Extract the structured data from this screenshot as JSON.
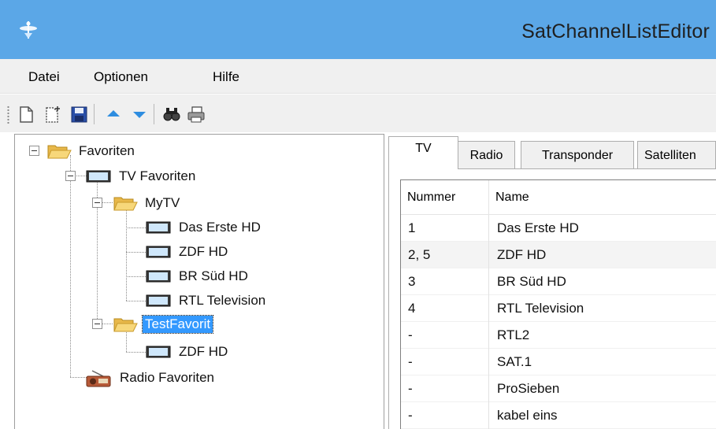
{
  "window": {
    "title": "SatChannelListEditor"
  },
  "menu": {
    "items": [
      "Datei",
      "Optionen",
      "Hilfe"
    ]
  },
  "toolbar": {
    "buttons": [
      "new-document-icon",
      "new-item-icon",
      "save-icon",
      "move-up-icon",
      "move-down-icon",
      "find-icon",
      "print-icon"
    ]
  },
  "tree": {
    "root": "Favoriten",
    "tv_favorites": "TV Favoriten",
    "mytv": "MyTV",
    "mytv_channels": [
      "Das Erste HD",
      "ZDF HD",
      "BR Süd HD",
      "RTL Television"
    ],
    "testfavorit": "TestFavorit",
    "testfavorit_channels": [
      "ZDF HD"
    ],
    "radio_favorites": "Radio Favoriten",
    "selected": "TestFavorit"
  },
  "tabs": [
    "TV",
    "Radio",
    "Transponder",
    "Satelliten"
  ],
  "active_tab": "TV",
  "grid": {
    "columns": [
      "Nummer",
      "Name"
    ],
    "rows": [
      {
        "nummer": "1",
        "name": "Das Erste HD"
      },
      {
        "nummer": "2, 5",
        "name": "ZDF HD"
      },
      {
        "nummer": "3",
        "name": "BR Süd HD"
      },
      {
        "nummer": "4",
        "name": "RTL Television"
      },
      {
        "nummer": "-",
        "name": "RTL2"
      },
      {
        "nummer": "-",
        "name": "SAT.1"
      },
      {
        "nummer": "-",
        "name": "ProSieben"
      },
      {
        "nummer": "-",
        "name": "kabel eins"
      }
    ]
  }
}
